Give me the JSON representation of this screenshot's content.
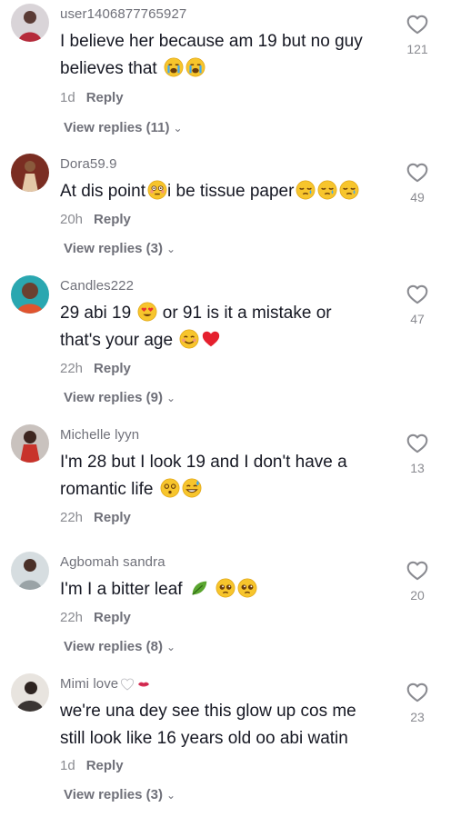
{
  "comments": [
    {
      "username": "user1406877765927",
      "line1": "I believe her because am 19 but no guy",
      "line2": "believes that",
      "time": "1d",
      "reply": "Reply",
      "view_replies": "View replies (11)",
      "likes": "121",
      "emojis": [
        "loudly-crying-face",
        "loudly-crying-face"
      ]
    },
    {
      "username": "Dora59.9",
      "line1a": "At dis point",
      "line1b": "i be tissue paper",
      "time": "20h",
      "reply": "Reply",
      "view_replies": "View replies (3)",
      "likes": "49",
      "emojis": [
        "flushed-face",
        "sleepy-face",
        "sleepy-face",
        "sleepy-face"
      ]
    },
    {
      "username": "Candles222",
      "line1a": "29 abi 19",
      "line1b": "or 91 is it a mistake or",
      "line2": "that's your age",
      "time": "22h",
      "reply": "Reply",
      "view_replies": "View replies (9)",
      "likes": "47",
      "emojis": [
        "heart-eyes-face",
        "smiling-face",
        "red-heart"
      ]
    },
    {
      "username": "Michelle lyyn",
      "line1": "I'm 28 but I look 19 and I don't have a",
      "line2": "romantic life",
      "time": "22h",
      "reply": "Reply",
      "likes": "13",
      "emojis": [
        "dizzy-face",
        "grinning-sweat-face"
      ]
    },
    {
      "username": "Agbomah sandra",
      "line1": "I'm I a bitter leaf",
      "time": "22h",
      "reply": "Reply",
      "view_replies": "View replies (8)",
      "likes": "20",
      "emojis": [
        "leaf",
        "pleading-face",
        "pleading-face"
      ]
    },
    {
      "username": "Mimi love",
      "line1": "we're una dey see this glow up cos me",
      "line2": "still look like 16 years old oo abi watin",
      "time": "1d",
      "reply": "Reply",
      "view_replies": "View replies (3)",
      "likes": "23",
      "emojis": [
        "white-heart",
        "kiss-mark"
      ]
    }
  ],
  "icons": {
    "like": "heart-outline-icon",
    "expand": "chevron-down-icon"
  },
  "colors": {
    "text": "#161823",
    "muted": "#8a8b91",
    "username": "#6f7079"
  }
}
